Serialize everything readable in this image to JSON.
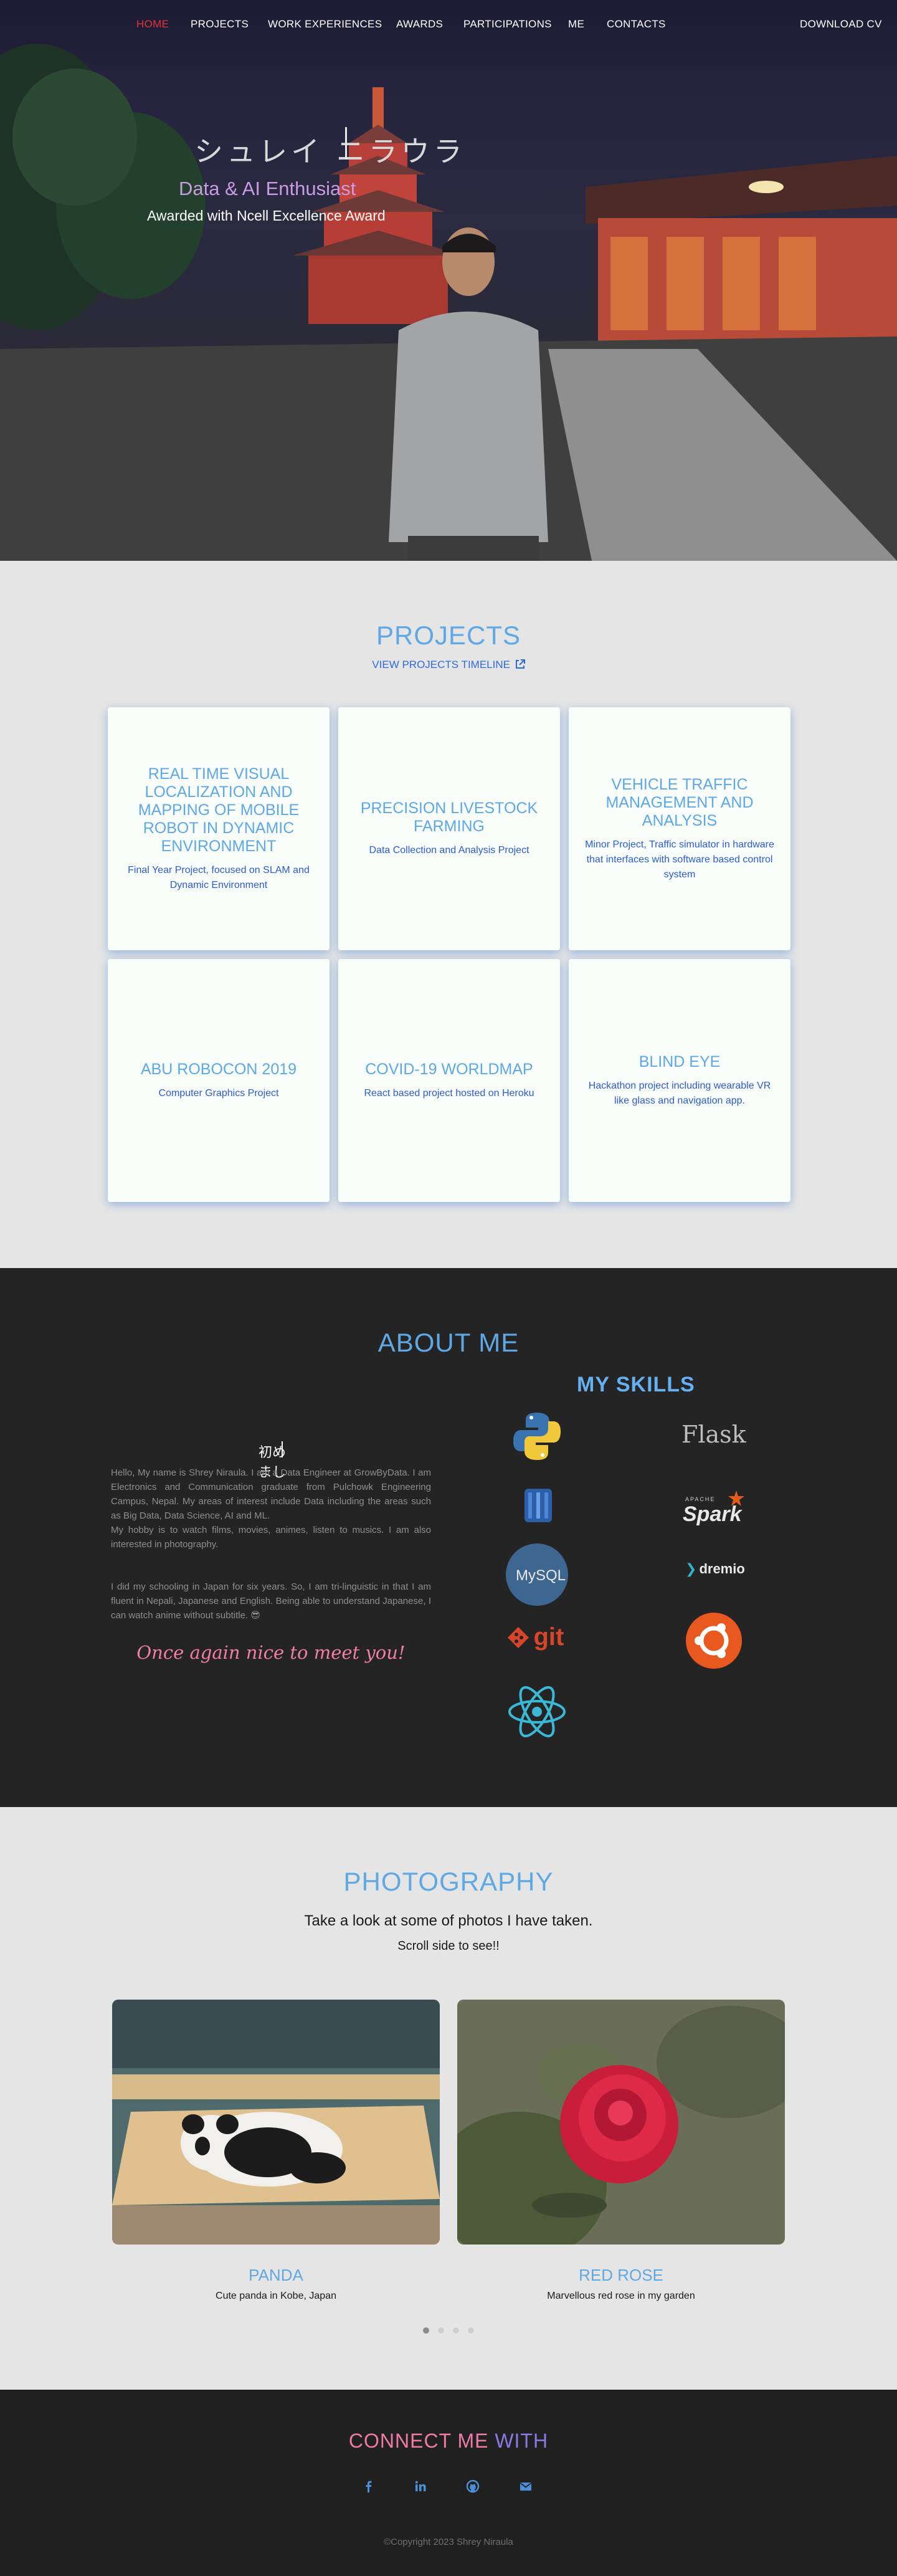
{
  "nav": {
    "home": "HOME",
    "projects": "PROJECTS",
    "work": "WORK EXPERIENCES",
    "awards": "AWARDS",
    "participations": "PARTICIPATIONS",
    "me": "ME",
    "contacts": "CONTACTS",
    "download": "DOWNLOAD CV",
    "accent_color": "#e0333b"
  },
  "hero": {
    "name_jp": "シュレイ ニラウラ",
    "subtitle": "Data & AI Enthusiast",
    "award": "Awarded with Ncell Excellence Award"
  },
  "projects": {
    "title": "PROJECTS",
    "timeline_link": "VIEW PROJECTS TIMELINE",
    "cards": [
      {
        "title": "REAL TIME VISUAL LOCALIZATION AND MAPPING OF MOBILE ROBOT IN DYNAMIC ENVIRONMENT",
        "desc": "Final Year Project, focused on SLAM and Dynamic Environment"
      },
      {
        "title": "PRECISION LIVESTOCK FARMING",
        "desc": "Data Collection and Analysis Project"
      },
      {
        "title": "VEHICLE TRAFFIC MANAGEMENT AND ANALYSIS",
        "desc": "Minor Project, Traffic simulator in hardware that interfaces with software based control system"
      },
      {
        "title": "ABU ROBOCON 2019",
        "desc": "Computer Graphics Project"
      },
      {
        "title": "COVID-19 WORLDMAP",
        "desc": "React based project hosted on Heroku"
      },
      {
        "title": "BLIND EYE",
        "desc": "Hackathon project including wearable VR like glass and navigation app."
      }
    ]
  },
  "about": {
    "title": "ABOUT ME",
    "greeting_jp": "初めまし",
    "para1": "Hello, My name is Shrey Niraula. I am a Data Engineer at GrowByData. I am Electronics and Communication graduate from Pulchowk Engineering Campus, Nepal. My areas of interest include Data including the areas such as Big Data, Data Science, AI and ML.",
    "para2": "My hobby is to watch films, movies, animes, listen to musics. I am also interested in photography.",
    "para3": "I did my schooling in Japan for six years. So, I am tri-linguistic in that I am fluent in Nepali, Japanese and English. Being able to understand Japanese, I can watch anime without subtitle. 😎",
    "closing": "Once again nice to meet you!",
    "skills_title": "MY SKILLS",
    "skills": {
      "python": "python-logo",
      "flask": "Flask",
      "bigquery": "bigquery-logo",
      "spark": "Spark",
      "spark_small": "APACHE",
      "mysql": "MySQL",
      "dremio": "dremio",
      "git": "git",
      "ubuntu": "ubuntu-logo",
      "react": "react-logo"
    }
  },
  "photography": {
    "title": "PHOTOGRAPHY",
    "tagline": "Take a look at some of photos I have taken.",
    "scroll_hint": "Scroll side to see!!",
    "items": [
      {
        "title": "PANDA",
        "desc": "Cute panda in Kobe, Japan"
      },
      {
        "title": "RED ROSE",
        "desc": "Marvellous red rose in my garden"
      }
    ]
  },
  "footer": {
    "connect_a": "CONNECT ME ",
    "connect_b": "WITH",
    "copyright": "©Copyright 2023 Shrey Niraula"
  }
}
